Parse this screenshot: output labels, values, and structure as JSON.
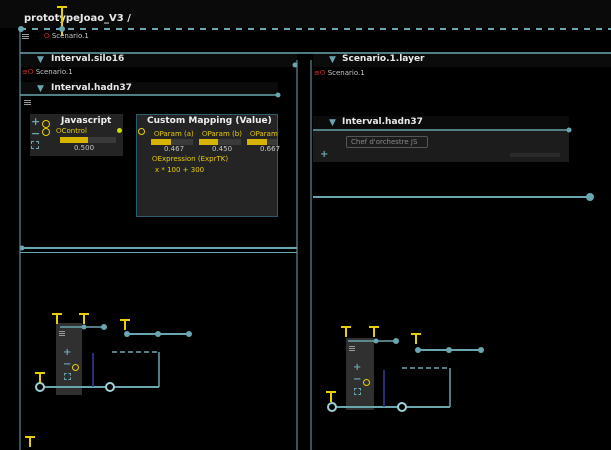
{
  "title": "prototypeJoao_V3 /",
  "scenario_root": "Scenario.1",
  "left": {
    "interval_title": "Interval.silo16",
    "scenario": "Scenario.1",
    "inner_interval_title": "Interval.hadn37",
    "javascript": {
      "title": "Javascript",
      "control_label": "Control",
      "control_value": "0.500",
      "control_fraction": 0.5
    },
    "mapping": {
      "title": "Custom Mapping (Value)",
      "params": [
        {
          "label": "Param (a)",
          "value": "0.467",
          "fraction": 0.467
        },
        {
          "label": "Param (b)",
          "value": "0.450",
          "fraction": 0.45
        },
        {
          "label": "Param",
          "value": "0.667",
          "fraction": 0.667
        }
      ],
      "expression_label": "Expression (ExprTK)",
      "expression_value": "x * 100 + 300"
    }
  },
  "right": {
    "scenario_title": "Scenario.1.layer",
    "scenario": "Scenario.1",
    "interval_title": "Interval.hadn37",
    "input_text": "Chef d'orchestre JS"
  },
  "colors": {
    "accent": "#6aa6b0",
    "yellow": "#e8d000",
    "header": "#0b0b0b",
    "node": "#242424"
  }
}
